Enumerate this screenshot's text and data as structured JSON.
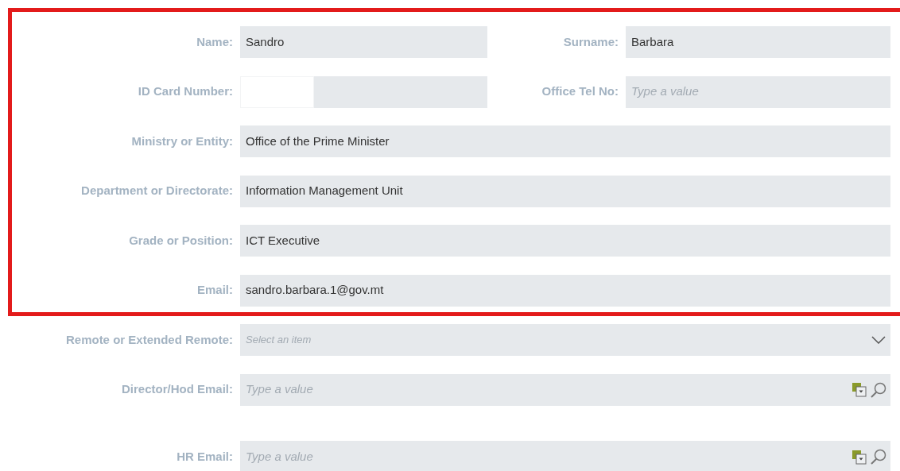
{
  "groups": [
    {
      "highlighted": true,
      "rows": [
        {
          "fields": [
            {
              "kind": "text",
              "label": "Name:",
              "value": "Sandro"
            },
            {
              "kind": "text",
              "label": "Surname:",
              "value": "Barbara"
            }
          ]
        },
        {
          "fields": [
            {
              "kind": "split",
              "label": "ID Card Number:"
            },
            {
              "kind": "text",
              "label": "Office Tel No:",
              "placeholder": "Type a value"
            }
          ]
        },
        {
          "fields": [
            {
              "kind": "text",
              "label": "Ministry or Entity:",
              "value": "Office of the Prime Minister"
            }
          ]
        },
        {
          "fields": [
            {
              "kind": "text",
              "label": "Department or Directorate:",
              "value": "Information Management Unit"
            }
          ]
        },
        {
          "fields": [
            {
              "kind": "text",
              "label": "Grade or Position:",
              "value": "ICT Executive"
            }
          ]
        },
        {
          "fields": [
            {
              "kind": "text",
              "label": "Email:",
              "value": "sandro.barbara.1@gov.mt"
            }
          ]
        }
      ]
    },
    {
      "highlighted": false,
      "rows": [
        {
          "fields": [
            {
              "kind": "select",
              "label": "Remote or Extended Remote:",
              "placeholder": "Select an item"
            }
          ]
        },
        {
          "fields": [
            {
              "kind": "lookup",
              "label": "Director/Hod Email:",
              "placeholder": "Type a value"
            }
          ]
        },
        {
          "fields": [
            {
              "kind": "lookup",
              "label": "HR Email:",
              "placeholder": "Type a value"
            }
          ]
        }
      ]
    }
  ]
}
